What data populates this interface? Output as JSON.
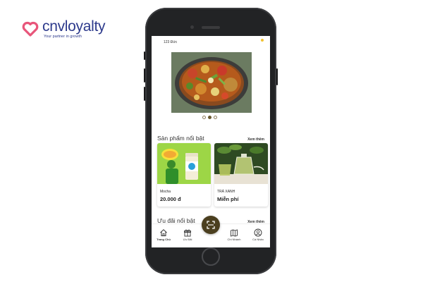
{
  "brand": {
    "name": "cnvloyalty",
    "tagline": "Your partner in growth",
    "color": "#2d3a8c",
    "heart_color": "#e8557a"
  },
  "app": {
    "status_text": "123 Đức",
    "banner": {
      "slide_count": 3,
      "active_slide": 2
    },
    "featured_products": {
      "title": "Sản phẩm nổi bật",
      "more_label": "Xem thêm",
      "items": [
        {
          "name": "Mocha",
          "price": "20.000 đ"
        },
        {
          "name": "TRÀ XANH",
          "price": "Miễn phí"
        }
      ]
    },
    "featured_offers": {
      "title": "Ưu đãi nổi bật",
      "more_label": "Xem thêm"
    },
    "nav": {
      "items": [
        {
          "label": "Trang Chủ",
          "icon": "home-icon",
          "active": true
        },
        {
          "label": "Ưu Đãi",
          "icon": "gift-icon",
          "active": false
        },
        {
          "label": "Chi Nhánh",
          "icon": "map-icon",
          "active": false
        },
        {
          "label": "Cá Nhân",
          "icon": "user-icon",
          "active": false
        }
      ],
      "scan_icon": "scan-icon"
    },
    "accent_color": "#4b3f1f"
  }
}
